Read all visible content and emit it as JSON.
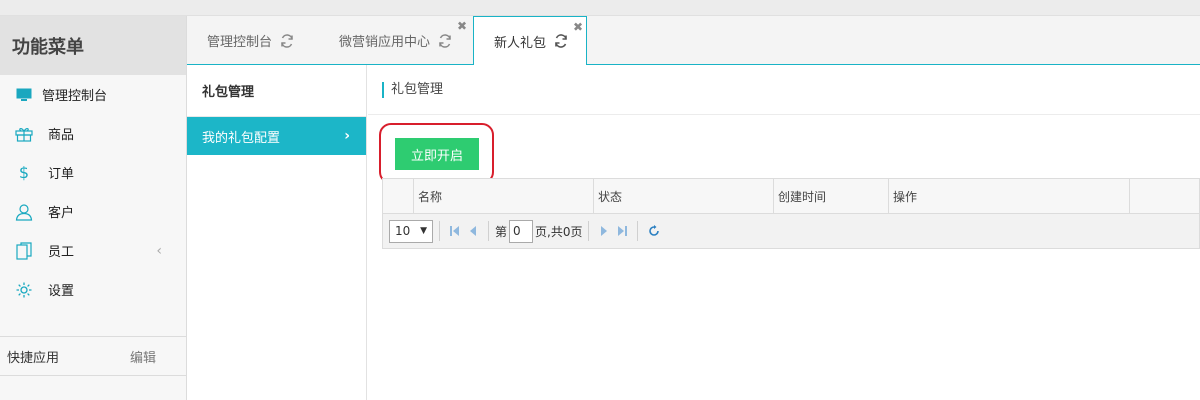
{
  "sidebar": {
    "title": "功能菜单",
    "items": [
      {
        "label": "管理控制台",
        "icon": "monitor-icon"
      },
      {
        "label": "商品",
        "icon": "gift-icon"
      },
      {
        "label": "订单",
        "icon": "dollar-icon"
      },
      {
        "label": "客户",
        "icon": "user-icon"
      },
      {
        "label": "员工",
        "icon": "document-icon"
      },
      {
        "label": "设置",
        "icon": "gear-icon"
      }
    ],
    "quick_apps_label": "快捷应用",
    "edit_label": "编辑"
  },
  "tabs": [
    {
      "label": "管理控制台",
      "closable": false,
      "active": false
    },
    {
      "label": "微营销应用中心",
      "closable": true,
      "active": false
    },
    {
      "label": "新人礼包",
      "closable": true,
      "active": true
    }
  ],
  "subnav": {
    "title": "礼包管理",
    "items": [
      {
        "label": "我的礼包配置",
        "active": true
      }
    ]
  },
  "main": {
    "breadcrumb": "礼包管理",
    "open_button": "立即开启",
    "columns": [
      "名称",
      "状态",
      "创建时间",
      "操作"
    ],
    "pager": {
      "page_size": "10",
      "page_prefix": "第",
      "page_value": "0",
      "page_suffix": "页,共0页"
    }
  },
  "colors": {
    "accent": "#1cb6c8",
    "button_green": "#2ecc71",
    "highlight_red": "#d81e2c"
  }
}
